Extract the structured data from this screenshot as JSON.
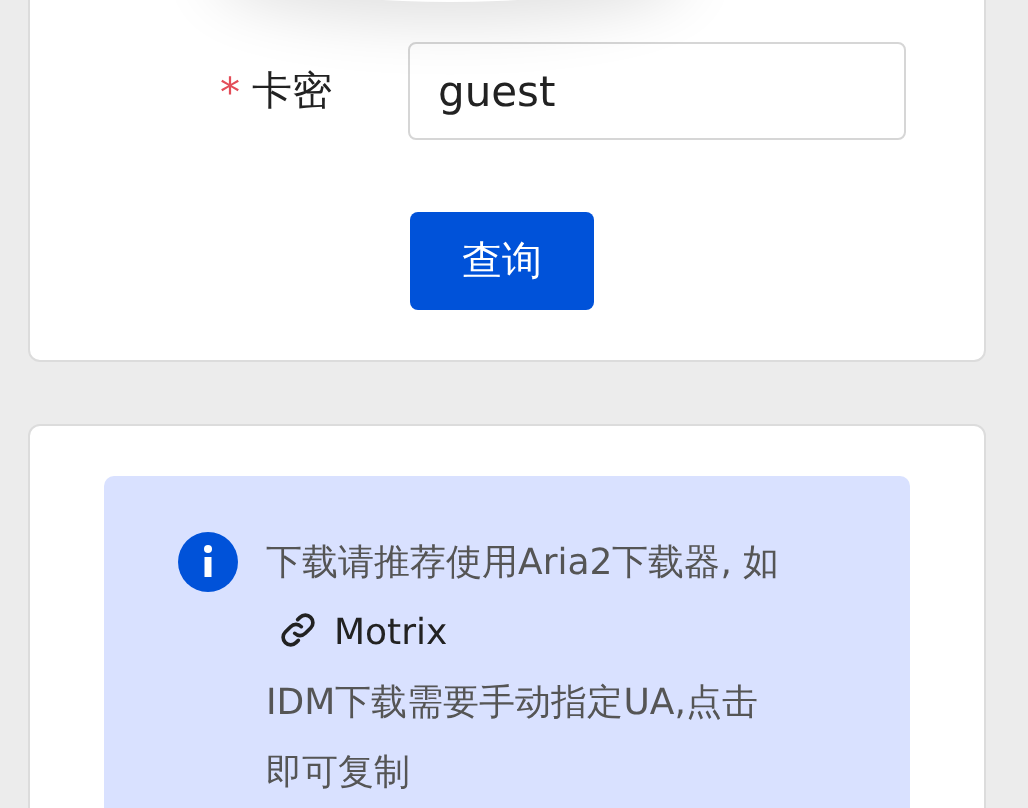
{
  "query_form": {
    "field": {
      "label": "卡密",
      "required_mark": "*",
      "value": "guest"
    },
    "submit_button": "查询"
  },
  "notice": {
    "kind": "info",
    "paragraphs": [
      {
        "text": "下载请推荐使用Aria2下载器, 如",
        "link": "Motrix"
      },
      {
        "text": "IDM下载需要手动指定UA,点击即可复制"
      }
    ]
  }
}
